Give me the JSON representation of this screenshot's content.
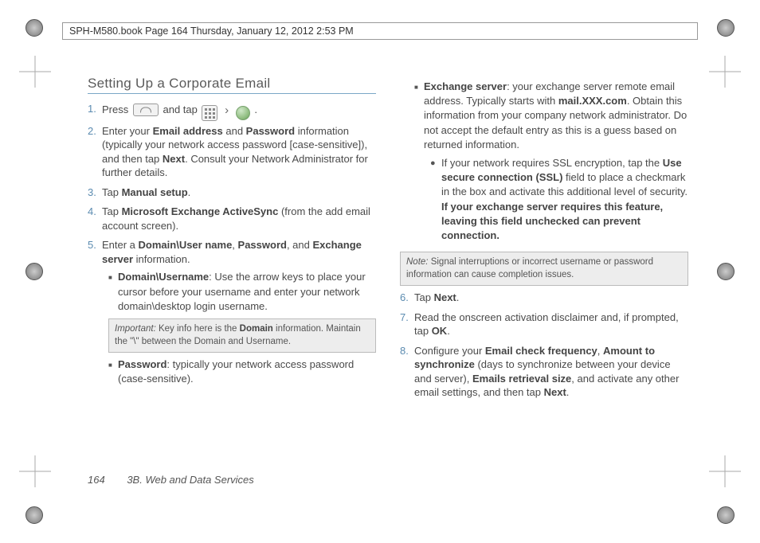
{
  "crop_header": "SPH-M580.book  Page 164  Thursday, January 12, 2012  2:53 PM",
  "title": "Setting Up a Corporate Email",
  "steps": {
    "s1_a": "Press",
    "s1_b": "and tap",
    "s1_c": ".",
    "s2_a": "Enter your ",
    "s2_email": "Email address",
    "s2_and": " and ",
    "s2_pw": "Password",
    "s2_b": " information (typically your network access password [case-sensitive]), and then tap ",
    "s2_next": "Next",
    "s2_c": ". Consult your Network Administrator for further details.",
    "s3_a": "Tap ",
    "s3_b": "Manual setup",
    "s3_c": ".",
    "s4_a": "Tap ",
    "s4_b": "Microsoft Exchange ActiveSync",
    "s4_c": " (from the add email account screen).",
    "s5_a": "Enter a ",
    "s5_dom": "Domain\\User name",
    "s5_comma": ", ",
    "s5_pw": "Password",
    "s5_and": ", and ",
    "s5_ex": "Exchange server",
    "s5_b": " information.",
    "s5_sub1_t": "Domain\\Username",
    "s5_sub1": ": Use the arrow keys to place your cursor before your username and enter your network domain\\desktop login username.",
    "s5_sub2_t": "Password",
    "s5_sub2": ": typically your network access password (case-sensitive).",
    "s5_sub3_t": "Exchange server",
    "s5_sub3_a": ": your exchange server remote email address. Typically starts with ",
    "s5_sub3_mail": "mail.XXX.com",
    "s5_sub3_b": ". Obtain this information from your company network administrator. Do not accept the default entry as this is a guess based on returned information.",
    "s5_ssl_a": "If your network requires SSL encryption, tap the ",
    "s5_ssl_b": "Use secure connection (SSL)",
    "s5_ssl_c": " field to place a checkmark in the box and activate this additional level of security. ",
    "s5_ssl_d": "If your exchange server requires this feature, leaving this field unchecked can prevent connection.",
    "s6_a": "Tap ",
    "s6_b": "Next",
    "s6_c": ".",
    "s7_a": "Read the onscreen activation disclaimer and, if prompted, tap ",
    "s7_b": "OK",
    "s7_c": ".",
    "s8_a": "Configure your ",
    "s8_ecf": "Email check frequency",
    "s8_comma1": ", ",
    "s8_ats": "Amount to synchronize",
    "s8_b": " (days to synchronize between your device and server), ",
    "s8_ers": "Emails retrieval size",
    "s8_c": ", and activate any other email settings, and then tap ",
    "s8_next": "Next",
    "s8_d": "."
  },
  "important": {
    "label": "Important:",
    "text_a": "Key info here is the ",
    "text_b": "Domain",
    "text_c": " information. Maintain the \"\\\" between the Domain and Username."
  },
  "note": {
    "label": "Note:",
    "text": "Signal interruptions or incorrect username or password information can cause completion issues."
  },
  "footer": {
    "page": "164",
    "section": "3B. Web and Data Services"
  }
}
